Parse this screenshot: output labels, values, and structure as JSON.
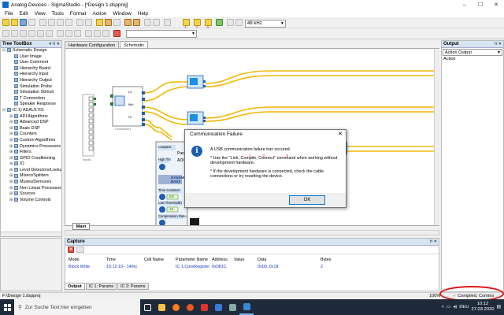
{
  "window": {
    "title": "Analog Devices - SigmaStudio - [*Design 1.dspproj]"
  },
  "menu": [
    "File",
    "Edit",
    "View",
    "Tools",
    "Format",
    "Action",
    "Window",
    "Help"
  ],
  "toolbar": {
    "sample_rate": "48 kHz",
    "marks": [
      "1",
      "2",
      "3"
    ]
  },
  "tree": {
    "header": "Tree ToolBox",
    "items": [
      {
        "label": "Schematic Design",
        "exp": "⊟",
        "level": 0
      },
      {
        "label": "User Image",
        "exp": "",
        "level": 1
      },
      {
        "label": "User Comment",
        "exp": "",
        "level": 1
      },
      {
        "label": "Hierarchy Board",
        "exp": "",
        "level": 1
      },
      {
        "label": "Hierarchy Input",
        "exp": "",
        "level": 1
      },
      {
        "label": "Hierarchy Output",
        "exp": "",
        "level": 1
      },
      {
        "label": "Simulation Probe",
        "exp": "",
        "level": 1
      },
      {
        "label": "Simulation Stimuli",
        "exp": "",
        "level": 1
      },
      {
        "label": "T Connection",
        "exp": "",
        "level": 1
      },
      {
        "label": "Speaker Response",
        "exp": "",
        "level": 1
      },
      {
        "label": "IC 1) ADAU1701",
        "exp": "⊟",
        "level": 0
      },
      {
        "label": "ADI Algorithms",
        "exp": "⊞",
        "level": 1
      },
      {
        "label": "Advanced DSP",
        "exp": "⊞",
        "level": 1
      },
      {
        "label": "Basic DSP",
        "exp": "⊞",
        "level": 1
      },
      {
        "label": "Counters",
        "exp": "⊞",
        "level": 1
      },
      {
        "label": "Custom Algorithms",
        "exp": "⊞",
        "level": 1
      },
      {
        "label": "Dynamics Processors",
        "exp": "⊞",
        "level": 1
      },
      {
        "label": "Filters",
        "exp": "⊞",
        "level": 1
      },
      {
        "label": "GPIO Conditioning",
        "exp": "⊞",
        "level": 1
      },
      {
        "label": "IO",
        "exp": "⊞",
        "level": 1
      },
      {
        "label": "Level Detectors/Lookup",
        "exp": "⊞",
        "level": 1
      },
      {
        "label": "Mixers/Splitters",
        "exp": "⊞",
        "level": 1
      },
      {
        "label": "Muxes/Demuxes",
        "exp": "⊞",
        "level": 1
      },
      {
        "label": "Non Linear Processors",
        "exp": "⊞",
        "level": 1
      },
      {
        "label": "Sources",
        "exp": "⊞",
        "level": 1
      },
      {
        "label": "Volume Controls",
        "exp": "⊞",
        "level": 1
      }
    ]
  },
  "canvas": {
    "tabs": [
      "Hardware Configuration",
      "Schematic"
    ],
    "active_tab": "Schematic",
    "main_tab": "Main",
    "blocks": {
      "input": "Input1",
      "crossover": "Crossover1",
      "crossover_labels": [
        "Lo",
        "Mid",
        "Hi"
      ],
      "lowpass": "Lowpass",
      "high_thr": "High Thr",
      "dynamic_bass": "DYNAMIC BASS",
      "time_constant": "Time Constant",
      "time_constant_val": "100",
      "low_thresh": "Low Thresh(dB)",
      "low_thresh_val": "-25",
      "compression": "Compression Ratio",
      "para1": "Para",
      "para2": "ADI"
    }
  },
  "dialog": {
    "title": "Communication Failure",
    "line1": "A USB communication failure has occured.",
    "line2": "* Use the \"Link, Compile, Connect\" command when working without development hardware.",
    "line3": "* If the development hardware is connected, check the cable connections or try resetting the device.",
    "marks": [
      "1",
      "2",
      "3"
    ],
    "ok_label": "OK"
  },
  "output": {
    "header": "Output",
    "select": "Action Output",
    "text": "Action"
  },
  "capture": {
    "header": "Capture",
    "columns": [
      "Mode",
      "Time",
      "Cell Name",
      "Parameter Name",
      "Address",
      "Value",
      "Data",
      "Bytes"
    ],
    "rows": [
      [
        "Block Write",
        "15:12:19 - 14ms",
        "",
        "IC 1.CoreRegister",
        "0x081C",
        "",
        "0x00, 0x18",
        "2"
      ]
    ],
    "bottom_tabs": [
      "Output",
      "IC 1: Params",
      "IC 2: Params"
    ]
  },
  "status": {
    "path": "F:\\Design 1.dspproj",
    "zoom": "100%",
    "text": "Compiled, Comms Failed"
  },
  "taskbar": {
    "search": "Zur Suche Text hier eingeben",
    "lang": "DEU",
    "time": "10:12",
    "date": "27.03.2020"
  }
}
